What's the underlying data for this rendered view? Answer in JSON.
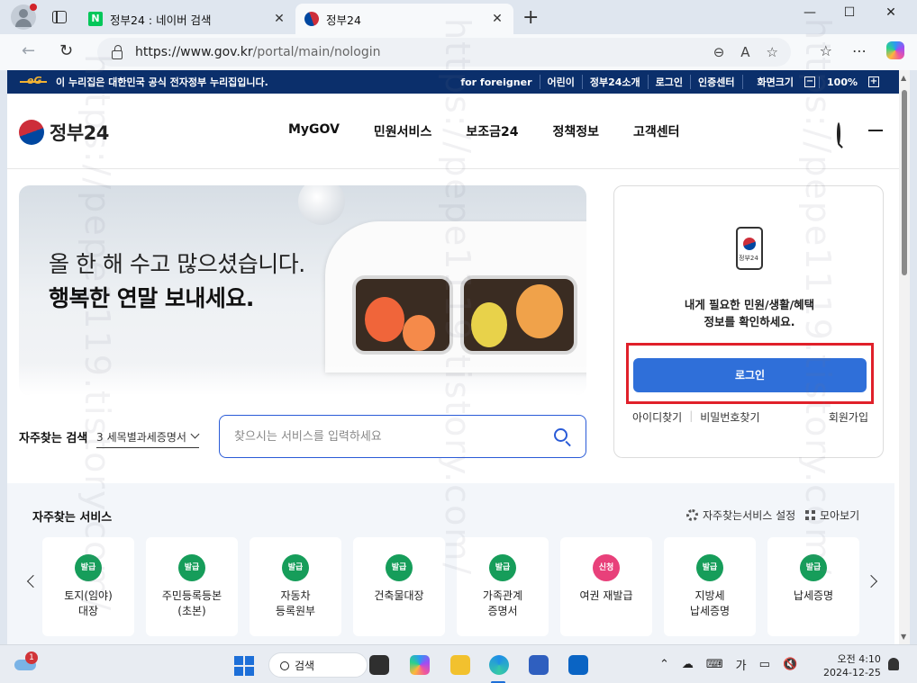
{
  "browser": {
    "tabs": [
      {
        "title": "정부24 : 네이버 검색",
        "favicon": "naver-n"
      },
      {
        "title": "정부24",
        "favicon": "gov24-taeguk"
      }
    ],
    "favicon_n_letter": "N",
    "url_host": "https://www.gov.kr",
    "url_path": "/portal/main/nologin"
  },
  "gov_banner": {
    "notice": "이 누리집은 대한민국 공식 전자정부 누리집입니다.",
    "links": [
      "for foreigner",
      "어린이",
      "정부24소개",
      "로그인",
      "인증센터"
    ],
    "zoom_label": "화면크기",
    "zoom_value": "100%",
    "zoom_minus": "−",
    "zoom_plus": "+"
  },
  "header": {
    "logo_text": "정부24",
    "nav": [
      "MyGOV",
      "민원서비스",
      "보조금24",
      "정책정보",
      "고객센터"
    ]
  },
  "hero": {
    "line1": "올 한 해 수고 많으셨습니다.",
    "line2": "행복한 연말 보내세요."
  },
  "search": {
    "label": "자주찾는 검색",
    "selected_rank": "3",
    "selected_term": "세목별과세증명서",
    "placeholder": "찾으시는 서비스를 입력하세요"
  },
  "login_card": {
    "phone_label": "정부24",
    "message_line1": "내게 필요한 민원/생활/혜택",
    "message_line2": "정보를 확인하세요.",
    "login_button": "로그인",
    "find_id": "아이디찾기",
    "find_pw": "비밀번호찾기",
    "signup": "회원가입",
    "highlight_color": "#e0202a"
  },
  "fav_services": {
    "title": "자주찾는 서비스",
    "settings": "자주찾는서비스 설정",
    "view_all": "모아보기",
    "items": [
      {
        "badge": "발급",
        "label": "토지(임야)\n대장",
        "color": "green"
      },
      {
        "badge": "발급",
        "label": "주민등록등본\n(초본)",
        "color": "green"
      },
      {
        "badge": "발급",
        "label": "자동차\n등록원부",
        "color": "green"
      },
      {
        "badge": "발급",
        "label": "건축물대장",
        "color": "green"
      },
      {
        "badge": "발급",
        "label": "가족관계\n증명서",
        "color": "green"
      },
      {
        "badge": "신청",
        "label": "여권 재발급",
        "color": "pink"
      },
      {
        "badge": "발급",
        "label": "지방세\n납세증명",
        "color": "green"
      },
      {
        "badge": "발급",
        "label": "납세증명",
        "color": "green"
      }
    ]
  },
  "watermark": "https://pepe1119.tistory.com/",
  "taskbar": {
    "search_label": "검색",
    "notification_count": "1",
    "ime": "가",
    "time": "오전 4:10",
    "date": "2024-12-25"
  },
  "colors": {
    "gov_navy": "#0b2f6b",
    "primary_blue": "#2f6fd9",
    "badge_green": "#169d5a",
    "badge_pink": "#e8407a"
  }
}
